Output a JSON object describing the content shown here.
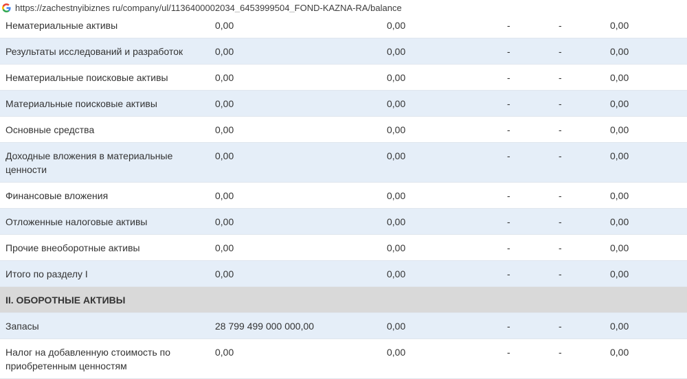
{
  "browser": {
    "url": "https://zachestnyibiznes ru/company/ul/1136400002034_6453999504_FOND-KAZNA-RA/balance"
  },
  "rows": [
    {
      "name": "Нематериальные активы",
      "v1": "0,00",
      "v2": "0,00",
      "v3": "-",
      "v4": "-",
      "v5": "0,00"
    },
    {
      "name": "Результаты исследований и разработок",
      "v1": "0,00",
      "v2": "0,00",
      "v3": "-",
      "v4": "-",
      "v5": "0,00"
    },
    {
      "name": "Нематериальные поисковые активы",
      "v1": "0,00",
      "v2": "0,00",
      "v3": "-",
      "v4": "-",
      "v5": "0,00"
    },
    {
      "name": "Материальные поисковые активы",
      "v1": "0,00",
      "v2": "0,00",
      "v3": "-",
      "v4": "-",
      "v5": "0,00"
    },
    {
      "name": "Основные средства",
      "v1": "0,00",
      "v2": "0,00",
      "v3": "-",
      "v4": "-",
      "v5": "0,00"
    },
    {
      "name": "Доходные вложения в материальные ценности",
      "v1": "0,00",
      "v2": "0,00",
      "v3": "-",
      "v4": "-",
      "v5": "0,00"
    },
    {
      "name": "Финансовые вложения",
      "v1": "0,00",
      "v2": "0,00",
      "v3": "-",
      "v4": "-",
      "v5": "0,00"
    },
    {
      "name": "Отложенные налоговые активы",
      "v1": "0,00",
      "v2": "0,00",
      "v3": "-",
      "v4": "-",
      "v5": "0,00"
    },
    {
      "name": "Прочие внеоборотные активы",
      "v1": "0,00",
      "v2": "0,00",
      "v3": "-",
      "v4": "-",
      "v5": "0,00"
    },
    {
      "name": "Итого по разделу I",
      "v1": "0,00",
      "v2": "0,00",
      "v3": "-",
      "v4": "-",
      "v5": "0,00"
    }
  ],
  "section2": {
    "title": "II. ОБОРОТНЫЕ АКТИВЫ",
    "rows": [
      {
        "name": "Запасы",
        "v1": "28 799 499 000 000,00",
        "v2": "0,00",
        "v3": "-",
        "v4": "-",
        "v5": "0,00"
      },
      {
        "name": "Налог на добавленную стоимость по приобретенным ценностям",
        "v1": "0,00",
        "v2": "0,00",
        "v3": "-",
        "v4": "-",
        "v5": "0,00"
      }
    ]
  },
  "icons": {
    "browser_favicon": "google-g-icon"
  }
}
